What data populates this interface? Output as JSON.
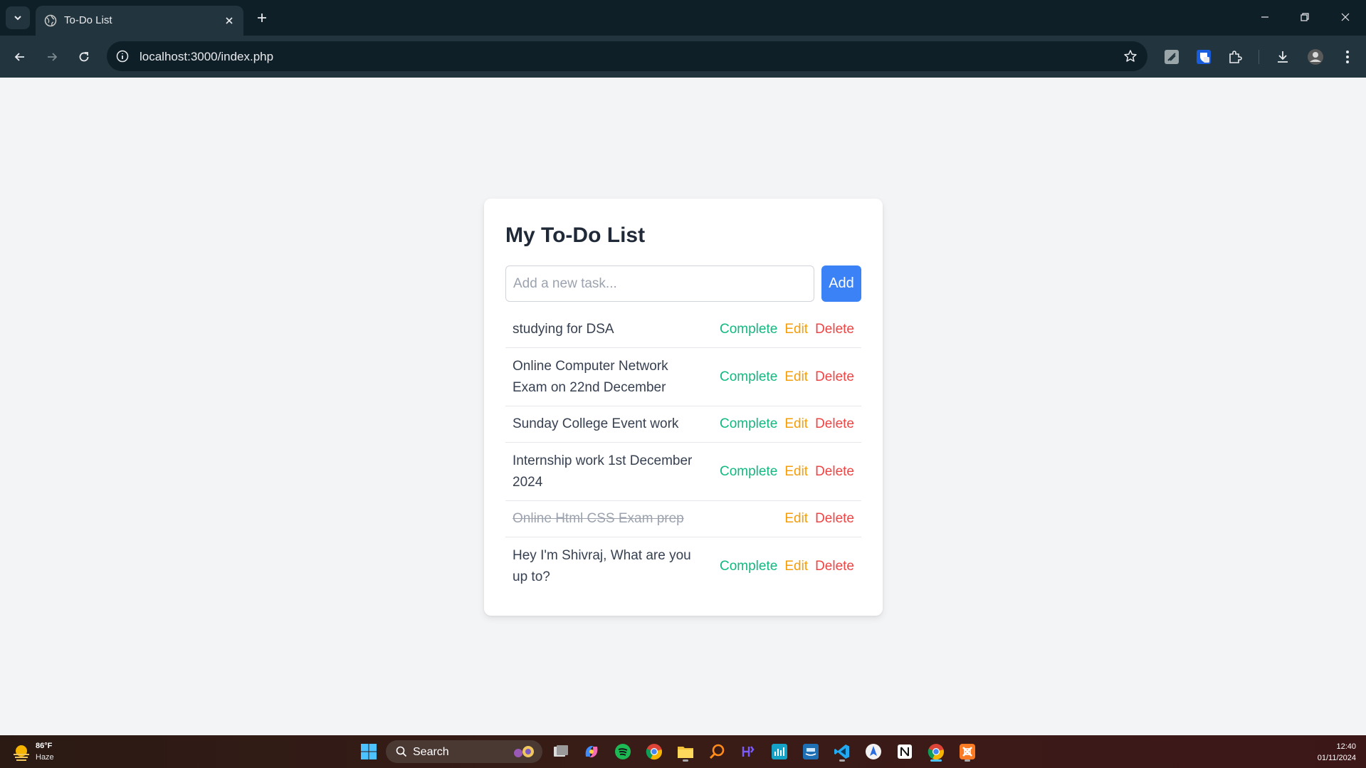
{
  "browser": {
    "tab_title": "To-Do List",
    "url": "localhost:3000/index.php"
  },
  "page": {
    "title": "My To-Do List",
    "input_placeholder": "Add a new task...",
    "input_value": "",
    "add_label": "Add",
    "complete_label": "Complete",
    "edit_label": "Edit",
    "delete_label": "Delete",
    "tasks": [
      {
        "text": "studying for DSA",
        "completed": false
      },
      {
        "text": "Online Computer Network Exam on 22nd December",
        "completed": false
      },
      {
        "text": "Sunday College Event work",
        "completed": false
      },
      {
        "text": "Internship work 1st December 2024",
        "completed": false
      },
      {
        "text": "Online Html CSS Exam prep",
        "completed": true
      },
      {
        "text": "Hey I'm Shivraj, What are you up to?",
        "completed": false
      }
    ]
  },
  "colors": {
    "add_button": "#3b82f6",
    "complete": "#10b981",
    "edit": "#f59e0b",
    "delete": "#ef4444"
  },
  "taskbar": {
    "weather_temp": "86°F",
    "weather_condition": "Haze",
    "search_label": "Search",
    "time": "12:40",
    "date": "01/11/2024"
  }
}
